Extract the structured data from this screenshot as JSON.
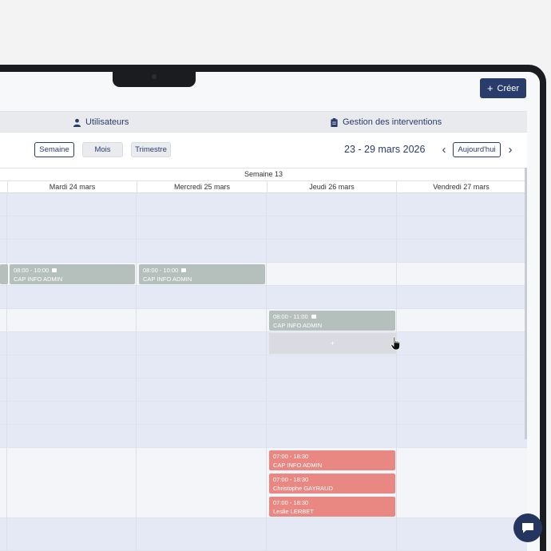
{
  "header": {
    "create_label": "Créer"
  },
  "tabs": [
    {
      "label": "Utilisateurs",
      "icon": "user-icon"
    },
    {
      "label": "Gestion des interventions",
      "icon": "clipboard-icon"
    }
  ],
  "toolbar": {
    "views": [
      {
        "label": "Semaine",
        "active": true
      },
      {
        "label": "Mois",
        "active": false
      },
      {
        "label": "Trimestre",
        "active": false
      }
    ],
    "date_range": "23 - 29 mars 2026",
    "today_label": "Aujourd'hui"
  },
  "calendar": {
    "week_label": "Semaine 13",
    "days": [
      "Mardi 24 mars",
      "Mercredi 25 mars",
      "Jeudi 26 mars",
      "Vendredi 27 mars"
    ],
    "events": [
      {
        "day": "Mardi 24 mars",
        "time": "08:00 - 10:00",
        "title": "CAP INFO ADMIN",
        "color": "#b5bfbc",
        "has_note": true
      },
      {
        "day": "Mercredi 25 mars",
        "time": "08:00 - 10:00",
        "title": "CAP INFO ADMIN",
        "color": "#b5bfbc",
        "has_note": true
      },
      {
        "day": "Jeudi 26 mars",
        "time": "08:00 - 11:00",
        "title": "CAP INFO ADMIN",
        "color": "#b5bfbc",
        "has_note": true
      },
      {
        "day": "Jeudi 26 mars",
        "time": "07:00 - 18:30",
        "title": "CAP INFO ADMIN",
        "color": "#e98882",
        "has_note": false
      },
      {
        "day": "Jeudi 26 mars",
        "time": "07:00 - 18:30",
        "title": "Christophe GAYRAUD",
        "color": "#e98882",
        "has_note": false
      },
      {
        "day": "Jeudi 26 mars",
        "time": "07:00 - 18:30",
        "title": "Leslie LERBET",
        "color": "#e98882",
        "has_note": false
      }
    ],
    "add_slot_label": "+"
  },
  "colors": {
    "accent": "#2a3c6b",
    "row_blue": "#e5e9f6",
    "event_grey": "#b5bfbc",
    "event_red": "#e98882"
  }
}
